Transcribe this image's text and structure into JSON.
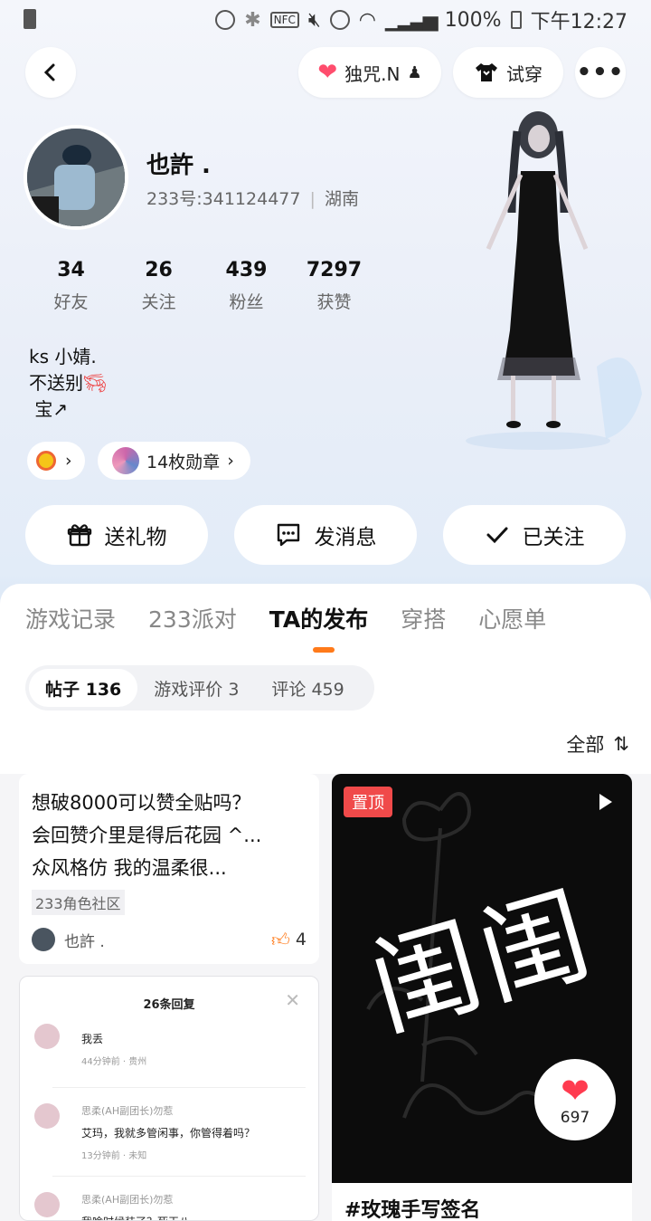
{
  "status_bar": {
    "battery": "100%",
    "time": "下午12:27"
  },
  "top_actions": {
    "title_badge": "独咒.N",
    "try_on": "试穿"
  },
  "profile": {
    "name": "也許 .",
    "uid": "233号:341124477",
    "region": "湖南",
    "stats": [
      {
        "value": "34",
        "label": "好友"
      },
      {
        "value": "26",
        "label": "关注"
      },
      {
        "value": "439",
        "label": "粉丝"
      },
      {
        "value": "7297",
        "label": "获赞"
      }
    ],
    "bio": [
      "ks 小婧.",
      "不送别",
      " 宝↗"
    ],
    "badges": "14枚勋章"
  },
  "actions": {
    "gift": "送礼物",
    "message": "发消息",
    "following": "已关注"
  },
  "tabs": [
    "游戏记录",
    "233派对",
    "TA的发布",
    "穿搭",
    "心愿单"
  ],
  "subtabs": [
    "帖子 136",
    "游戏评价 3",
    "评论 459"
  ],
  "sort": "全部",
  "posts": {
    "card1": {
      "lines": [
        "想破8000可以赞全贴吗？",
        "会回赞介里是得后花园 ^...",
        "众风格仿 我的温柔很..."
      ],
      "tag": "233角色社区",
      "author": "也許 .",
      "likes": "4"
    },
    "card2": {
      "header": "26条回复",
      "comments": [
        {
          "text": "我丢",
          "time": "44分钟前 · 贵州"
        },
        {
          "user": "思柔(AH副团长)勿惹",
          "text": "艾玛，我就多管闲事，你管得着吗？",
          "time": "13分钟前 · 未知"
        },
        {
          "user": "思柔(AH副团长)勿惹",
          "text": "我啥时候装了？死干八"
        }
      ]
    },
    "card3": {
      "pin": "置顶",
      "big_text": "闺闺",
      "likes": "697",
      "title": "#玫瑰手写签名"
    }
  }
}
